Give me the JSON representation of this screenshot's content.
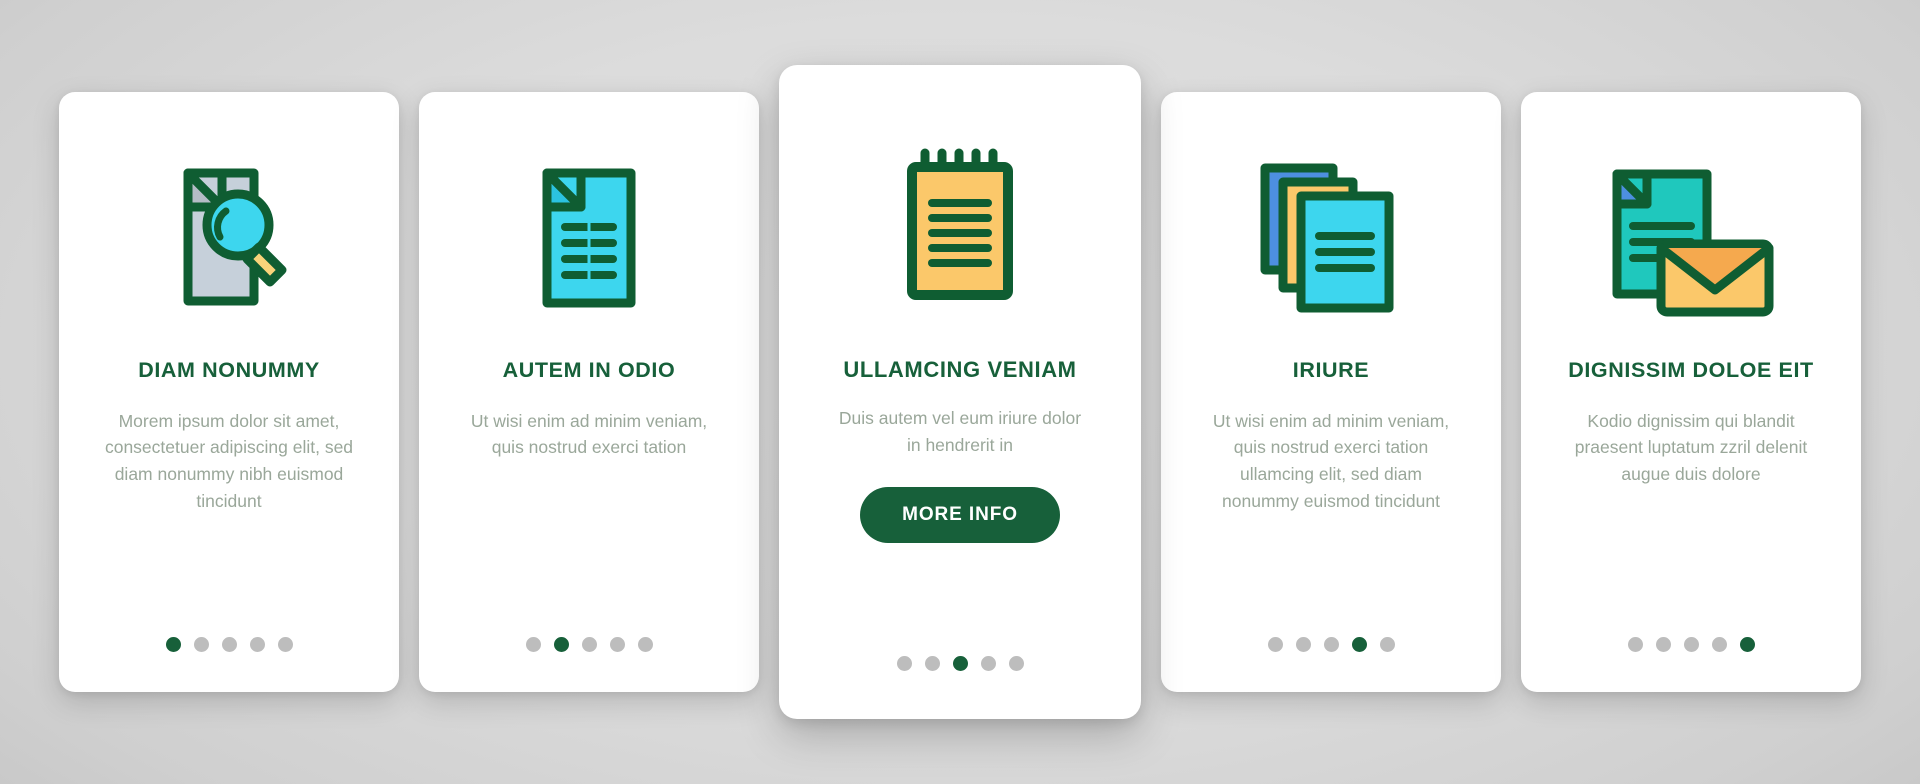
{
  "theme": {
    "background": "#d8d8d8",
    "card_bg": "#ffffff",
    "accent_green": "#17603a",
    "body_text": "#9aa79a",
    "dot_inactive": "#bdbdbd",
    "icon_cyan": "#3dd6ee",
    "icon_teal": "#1fc8bd",
    "icon_yellow": "#fbc86a",
    "icon_orange": "#f5a councils"
  },
  "carousel": {
    "total_slides": 5,
    "cards": [
      {
        "index": 1,
        "icon": "document-search-icon",
        "title": "DIAM NONUMMY",
        "body": "Morem ipsum dolor sit amet, consectetuer adipiscing elit, sed diam nonummy nibh euismod tincidunt",
        "active_dot": 1,
        "cta_label": null
      },
      {
        "index": 2,
        "icon": "document-lines-icon",
        "title": "AUTEM IN ODIO",
        "body": "Ut wisi enim ad minim veniam, quis nostrud exerci tation",
        "active_dot": 2,
        "cta_label": null
      },
      {
        "index": 3,
        "icon": "notepad-icon",
        "title": "ULLAMCING VENIAM",
        "body": "Duis autem vel eum iriure dolor in hendrerit in",
        "active_dot": 3,
        "cta_label": "MORE INFO"
      },
      {
        "index": 4,
        "icon": "document-stack-icon",
        "title": "IRIURE",
        "body": "Ut wisi enim ad minim veniam, quis nostrud exerci tation ullamcing elit, sed diam nonummy euismod tincidunt",
        "active_dot": 4,
        "cta_label": null
      },
      {
        "index": 5,
        "icon": "document-envelope-icon",
        "title": "DIGNISSIM DOLOE EIT",
        "body": "Kodio dignissim qui blandit praesent luptatum zzril delenit augue duis dolore",
        "active_dot": 5,
        "cta_label": null
      }
    ]
  }
}
